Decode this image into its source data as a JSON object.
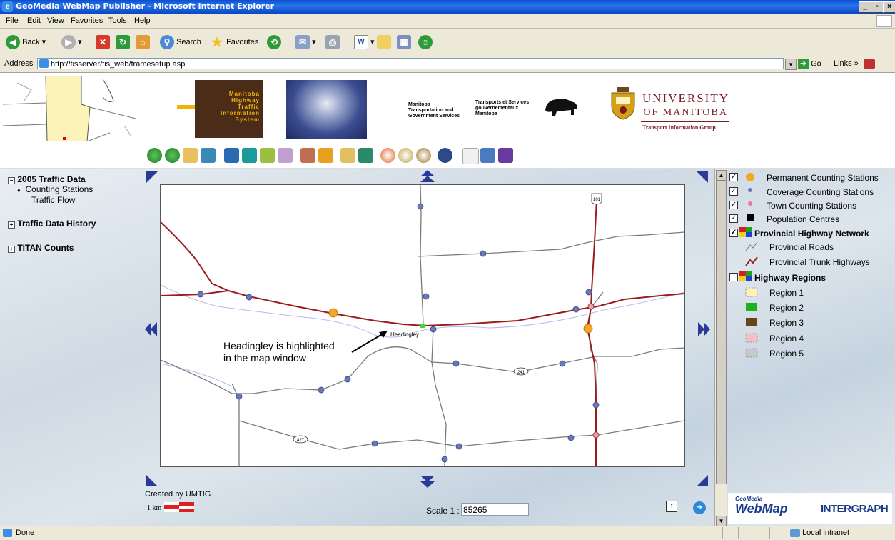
{
  "window": {
    "title": "GeoMedia WebMap Publisher - Microsoft Internet Explorer",
    "minimize": "_",
    "maximize": "▫",
    "close": "×"
  },
  "menu": [
    "File",
    "Edit",
    "View",
    "Favorites",
    "Tools",
    "Help"
  ],
  "toolbar": {
    "back": "Back",
    "search": "Search",
    "favorites": "Favorites"
  },
  "address": {
    "label": "Address",
    "url": "http://tisserver/tis_web/framesetup.asp",
    "go": "Go",
    "links": "Links"
  },
  "banner": {
    "mhtis_lines": [
      "Manitoba",
      "Highway",
      "Traffic",
      "Information",
      "System"
    ],
    "mtgs_en": [
      "Manitoba",
      "Transportation and",
      "Government Services"
    ],
    "mtgs_fr": [
      "Transports et Services",
      "gouvernementaux",
      "Manitoba"
    ],
    "university": [
      "UNIVERSITY",
      "OF MANITOBA"
    ],
    "group": "Transport Information Group"
  },
  "left_panel": {
    "sections": [
      {
        "label": "2005 Traffic Data",
        "expanded": true,
        "items": [
          "Counting Stations",
          "Traffic Flow"
        ],
        "selected": 0
      },
      {
        "label": "Traffic Data History",
        "expanded": false,
        "items": []
      },
      {
        "label": "TITAN Counts",
        "expanded": false,
        "items": []
      }
    ]
  },
  "map": {
    "annotation": [
      "Headingley is highlighted",
      "in the map window"
    ],
    "place_label": "Headingley",
    "shields": [
      "101",
      "241",
      "427"
    ],
    "credit": "Created by UMTIG",
    "scalebar_label": "1 km",
    "scale_label": "Scale 1 :",
    "scale_value": "85265"
  },
  "legend": {
    "items": [
      {
        "label": "Permanent Counting Stations",
        "checked": true,
        "symbol": "orange-dot"
      },
      {
        "label": "Coverage Counting Stations",
        "checked": true,
        "symbol": "blue-dot"
      },
      {
        "label": "Town Counting Stations",
        "checked": true,
        "symbol": "pink-dot"
      },
      {
        "label": "Population Centres",
        "checked": true,
        "symbol": "black-square"
      },
      {
        "label": "Provincial Highway Network",
        "checked": true,
        "symbol": "layer-group",
        "bold": true
      },
      {
        "label": "Provincial Roads",
        "checked": null,
        "symbol": "grey-line"
      },
      {
        "label": "Provincial Trunk Highways",
        "checked": null,
        "symbol": "red-line"
      },
      {
        "label": "Highway Regions",
        "checked": false,
        "symbol": "layer-group",
        "bold": true
      },
      {
        "label": "Region 1",
        "checked": null,
        "symbol": "region-1"
      },
      {
        "label": "Region 2",
        "checked": null,
        "symbol": "region-2"
      },
      {
        "label": "Region 3",
        "checked": null,
        "symbol": "region-3"
      },
      {
        "label": "Region 4",
        "checked": null,
        "symbol": "region-4"
      },
      {
        "label": "Region 5",
        "checked": null,
        "symbol": "region-5"
      }
    ],
    "logo_left": "GeoMedia",
    "logo_left2": "WebMap",
    "logo_right": "INTERGRAPH"
  },
  "status": {
    "text": "Done",
    "zone": "Local intranet"
  },
  "colors": {
    "trunk": "#9b1c1c",
    "road": "#7a7a7a",
    "river": "#b9b9f0",
    "station_blue": "#6b78b8",
    "station_orange": "#f5a623",
    "station_pink": "#e8a0b0"
  }
}
